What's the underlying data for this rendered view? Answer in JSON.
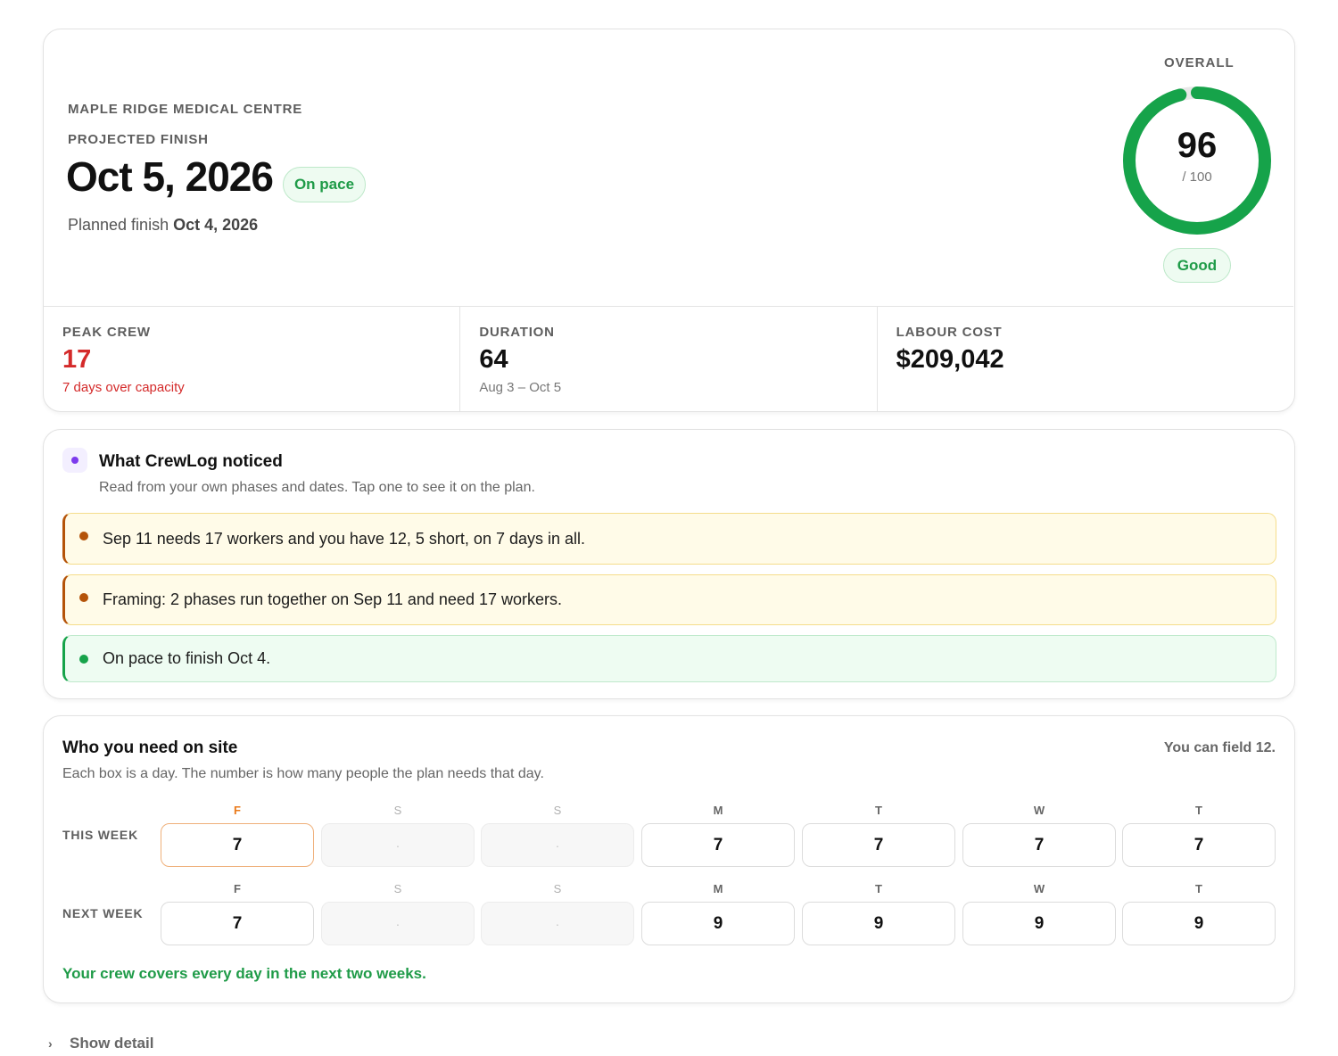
{
  "summary": {
    "site_name": "MAPLE RIDGE MEDICAL CENTRE",
    "projected_finish_label": "PROJECTED FINISH",
    "projected_finish": "Oct 5, 2026",
    "pace_badge": "On pace",
    "planned_prefix": "Planned finish",
    "planned_finish": "Oct 4, 2026",
    "overall_label": "OVERALL",
    "score": "96",
    "score_max": "/ 100",
    "score_fraction": 0.96,
    "score_badge": "Good",
    "colors": {
      "good": "#16a34a",
      "alert": "#d42a2a"
    }
  },
  "stats": [
    {
      "label": "PEAK CREW",
      "value": "17",
      "sub": "7 days over capacity"
    },
    {
      "label": "DURATION",
      "value": "64",
      "sub": "Aug 3 – Oct 5"
    },
    {
      "label": "LABOUR COST",
      "value": "$209,042",
      "sub": ""
    }
  ],
  "notices": {
    "title": "What CrewLog noticed",
    "subtitle": "Read from your own phases and dates. Tap one to see it on the plan.",
    "items": [
      {
        "text": "Sep 11 needs 17 workers and you have 12, 5 short, on 7 days in all.",
        "level": "warning"
      },
      {
        "text": "Framing: 2 phases run together on Sep 11 and need 17 workers.",
        "level": "warning"
      },
      {
        "text": "On pace to finish Oct 4.",
        "level": "ok"
      }
    ]
  },
  "crew": {
    "title": "Who you need on site",
    "capacity": "You can field 12.",
    "subtitle": "Each box is a day. The number is how many people the plan needs that day.",
    "weeks": [
      {
        "label": "THIS WEEK",
        "days": [
          {
            "letter": "F",
            "value": "7"
          },
          {
            "letter": "S",
            "value": "·"
          },
          {
            "letter": "S",
            "value": "·"
          },
          {
            "letter": "M",
            "value": "7"
          },
          {
            "letter": "T",
            "value": "7"
          },
          {
            "letter": "W",
            "value": "7"
          },
          {
            "letter": "T",
            "value": "7"
          }
        ]
      },
      {
        "label": "NEXT WEEK",
        "days": [
          {
            "letter": "F",
            "value": "7"
          },
          {
            "letter": "S",
            "value": "·"
          },
          {
            "letter": "S",
            "value": "·"
          },
          {
            "letter": "M",
            "value": "9"
          },
          {
            "letter": "T",
            "value": "9"
          },
          {
            "letter": "W",
            "value": "9"
          },
          {
            "letter": "T",
            "value": "9"
          }
        ]
      }
    ],
    "footer": "Your crew covers every day in the next two weeks."
  },
  "show_detail": "Show detail"
}
